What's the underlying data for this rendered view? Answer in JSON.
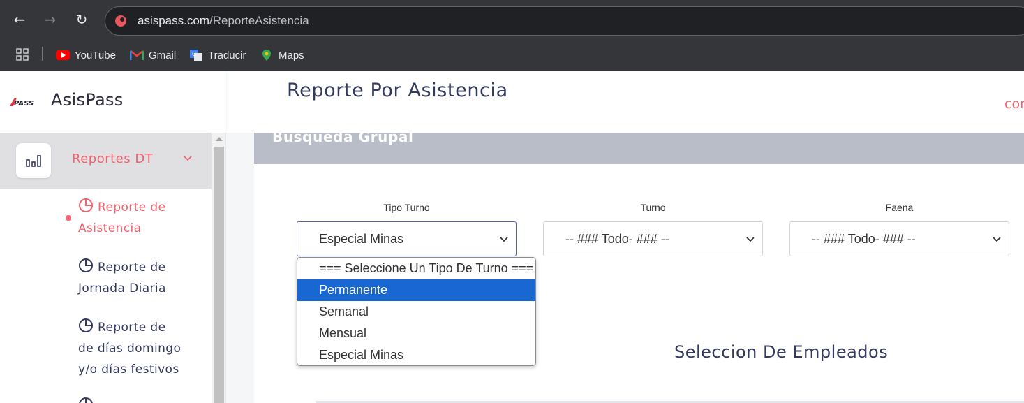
{
  "browser": {
    "url_host": "asispass.com",
    "url_path": "/ReporteAsistencia",
    "bookmarks": [
      {
        "label": "YouTube",
        "icon": "youtube-icon"
      },
      {
        "label": "Gmail",
        "icon": "gmail-icon"
      },
      {
        "label": "Traducir",
        "icon": "translate-icon"
      },
      {
        "label": "Maps",
        "icon": "maps-icon"
      }
    ]
  },
  "brand": {
    "name": "AsisPass",
    "logo_text": "APASS"
  },
  "sidebar": {
    "menu_label": "Reportes DT",
    "items": [
      {
        "line1": "Reporte de",
        "line2": "Asistencia",
        "active": true
      },
      {
        "line1": "Reporte de",
        "line2": "Jornada Diaria",
        "active": false
      },
      {
        "line1": "Reporte de",
        "line2": "de días domingo",
        "line3": "y/o días festivos",
        "active": false
      }
    ]
  },
  "header": {
    "title": "Reporte Por Asistencia",
    "right_cut": "cor"
  },
  "card": {
    "title": "Busqueda Grupal",
    "fields": [
      {
        "label": "Tipo Turno",
        "value": "Especial Minas"
      },
      {
        "label": "Turno",
        "value": "-- ### Todo- ### --"
      },
      {
        "label": "Faena",
        "value": "-- ### Todo- ### --"
      }
    ],
    "dropdown_options": [
      "=== Seleccione Un Tipo De Turno ===",
      "Permanente",
      "Semanal",
      "Mensual",
      "Especial Minas"
    ],
    "highlighted_option": "Permanente",
    "section_title": "Seleccion De Empleados"
  },
  "colors": {
    "accent": "#f0626d",
    "text": "#34395e",
    "highlight": "#1967d2",
    "card_header": "#b9bdc8"
  }
}
